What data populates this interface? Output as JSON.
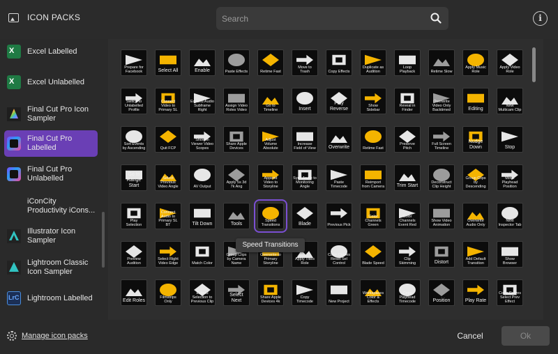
{
  "app": {
    "title": "ICON PACKS"
  },
  "search": {
    "placeholder": "Search"
  },
  "info": {
    "label": "i"
  },
  "sidebar": {
    "items": [
      {
        "label": "Excel Labelled",
        "icon": "excel-icon",
        "selected": false
      },
      {
        "label": "Excel Unlabelled",
        "icon": "excel-icon",
        "selected": false
      },
      {
        "label": "Final Cut Pro Icon Sampler",
        "icon": "final-cut-pro-icon",
        "selected": false
      },
      {
        "label": "Final Cut Pro Labelled",
        "icon": "final-cut-pro-color-icon",
        "selected": true
      },
      {
        "label": "Final Cut Pro Unlabelled",
        "icon": "final-cut-pro-color-icon",
        "selected": false
      },
      {
        "label": "iConCity Productivity iCons...",
        "icon": "",
        "selected": false
      },
      {
        "label": "Illustrator Icon Sampler",
        "icon": "illustrator-icon",
        "selected": false
      },
      {
        "label": "Lightroom Classic Icon Sampler",
        "icon": "lightroom-icon",
        "selected": false
      },
      {
        "label": "Lightroom Labelled",
        "icon": "lightroom-classic-icon",
        "selected": false
      }
    ],
    "manage_label": "Manage icon packs"
  },
  "grid": {
    "tiles": [
      "Prepare for Facebook",
      "Select All",
      "Enable",
      "Paste Effects",
      "Retime Fast",
      "Move to Trash",
      "Copy Effects",
      "Duplicate as Audition",
      "Loop Playback",
      "Retime Slow",
      "Apply Music Role",
      "Apply Video Role",
      "Switch to Unlabelled Profile",
      "Connect Video to Primary SL",
      "Expand Audio Subframe Right",
      "Assign Video Roles Video",
      "Go to Timeline",
      "Insert",
      "Play Reverse",
      "Show Sidebar",
      "Reveal in Finder",
      "Overwrite Video Only Backtimed",
      "Editing",
      "New Multicam Clip",
      "Sort Events by Ascending",
      "Quit FCP",
      "Show in Viewer Video Scopes",
      "Share Apple Devices",
      "Adjust Volume Absolute",
      "Increase Field of View",
      "Overwrite",
      "Retime Fast",
      "Preserve Pitch",
      "Full Screen Timeline",
      "Nudge Down",
      "Stop",
      "Go to Range Start",
      "Select Previous Video Angle",
      "AV Output",
      "Apply 5s 3d 7k Ang",
      "Append Video to Storyline",
      "Sync Angle to Monitoring Angle",
      "Paste Timecode",
      "Reimport from Camera",
      "Trim Start",
      "Deconstruct Clip Height",
      "Group Clips by Descending",
      "Move Playhead Position",
      "Play Selection",
      "Connect Audio to Primary SL BT",
      "Tilt Down",
      "Tools",
      "Speed Transitions",
      "Blade",
      "Previous Pick",
      "Color Channels Green",
      "Color Channels Event Red",
      "Show Video Animation",
      "Overwrite Audio Only",
      "Next Inspector Tab",
      "Preview Audition",
      "Select Right Video Edge",
      "Match Color",
      "Group Clips by Camera Name",
      "Overwrite to Primary Storyline",
      "Apply Titles Role",
      "Color Curves Reset Sel Control",
      "Blade Speed",
      "Clip Skimming",
      "Distort",
      "Add Default Transition",
      "Show Browser",
      "Edit Roles",
      "Filmstrips Only",
      "Extend Selection to Previous Clip",
      "Select Next",
      "Share Apple Devices 4k",
      "Copy Timecode",
      "New Project",
      "Workspaces Color & Effects",
      "Copy Playhead Timecode",
      "Position",
      "Play Rate",
      "Color Curves Select Prev Effect"
    ],
    "selected_tile": "Speed Transitions"
  },
  "tooltip": {
    "text": "Speed Transitions"
  },
  "footer": {
    "cancel_label": "Cancel",
    "ok_label": "Ok"
  },
  "colors": {
    "accent": "#6a3fb5",
    "highlight": "#7b4fd3",
    "icon_yellow": "#f4b400"
  }
}
